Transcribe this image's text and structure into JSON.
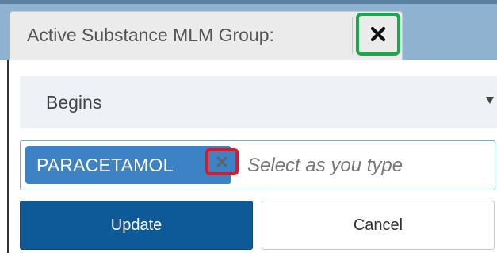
{
  "filter_header": {
    "label": "Active Substance MLM Group:",
    "clear_icon": "close-icon"
  },
  "condition": {
    "selected": "Begins",
    "icon": "caret-down-icon"
  },
  "tag_input": {
    "tags": [
      {
        "label": "PARACETAMOL",
        "remove_icon": "close-icon"
      }
    ],
    "placeholder": "Select as you type"
  },
  "actions": {
    "update_label": "Update",
    "cancel_label": "Cancel"
  },
  "colors": {
    "header_background": "#8fb2d0",
    "header_chip": "#ebebeb",
    "tag_chip": "#3d82c4",
    "primary_button": "#0e5a99",
    "highlight_green": "#19a84a",
    "highlight_red": "#e8141f"
  }
}
